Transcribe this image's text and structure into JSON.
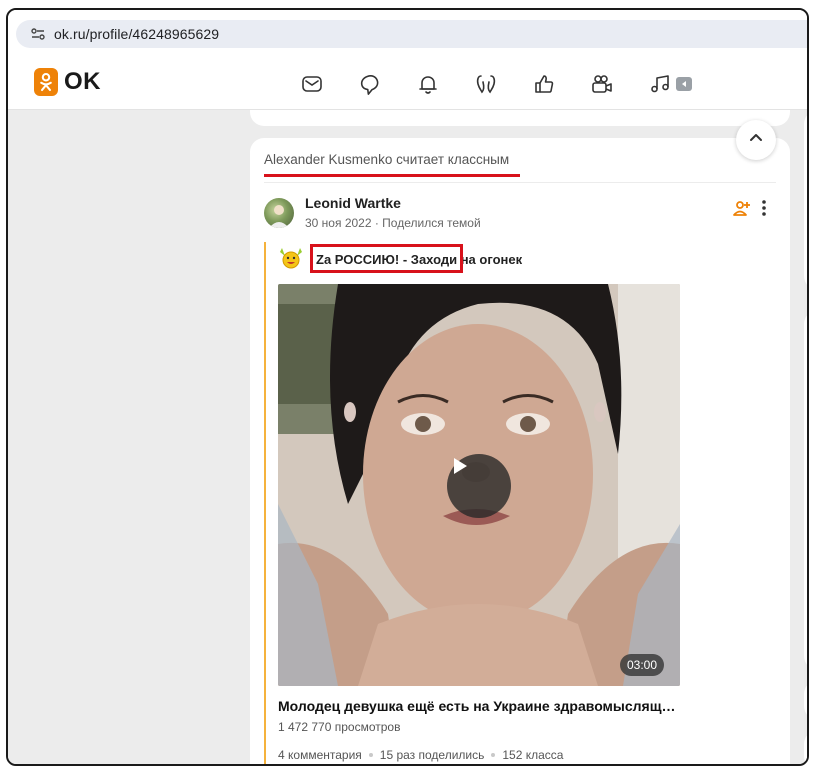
{
  "browser": {
    "url": "ok.ru/profile/46248965629"
  },
  "header": {
    "logo_text": "OK",
    "brand_color": "#ee8208",
    "nav_icons": [
      "messages-icon",
      "discussions-icon",
      "notifications-icon",
      "guests-icon",
      "likes-icon",
      "video-icon",
      "music-icon",
      "more-icon"
    ]
  },
  "feed": {
    "activity_text": "Alexander Kusmenko считает классным",
    "post": {
      "author": "Leonid Wartke",
      "meta": "30 ноя 2022 · Поделился темой",
      "group_title": "Za РОССИЮ! - Заходи на огонек",
      "video": {
        "duration": "03:00",
        "title": "Молодец девушка ещё есть на Украине здравомыслящ…",
        "views": "1 472 770 просмотров"
      },
      "stats": {
        "comments": "4 комментария",
        "shares": "15 раз поделились",
        "likes": "152 класса"
      }
    }
  },
  "accent_red": "#d8111b"
}
